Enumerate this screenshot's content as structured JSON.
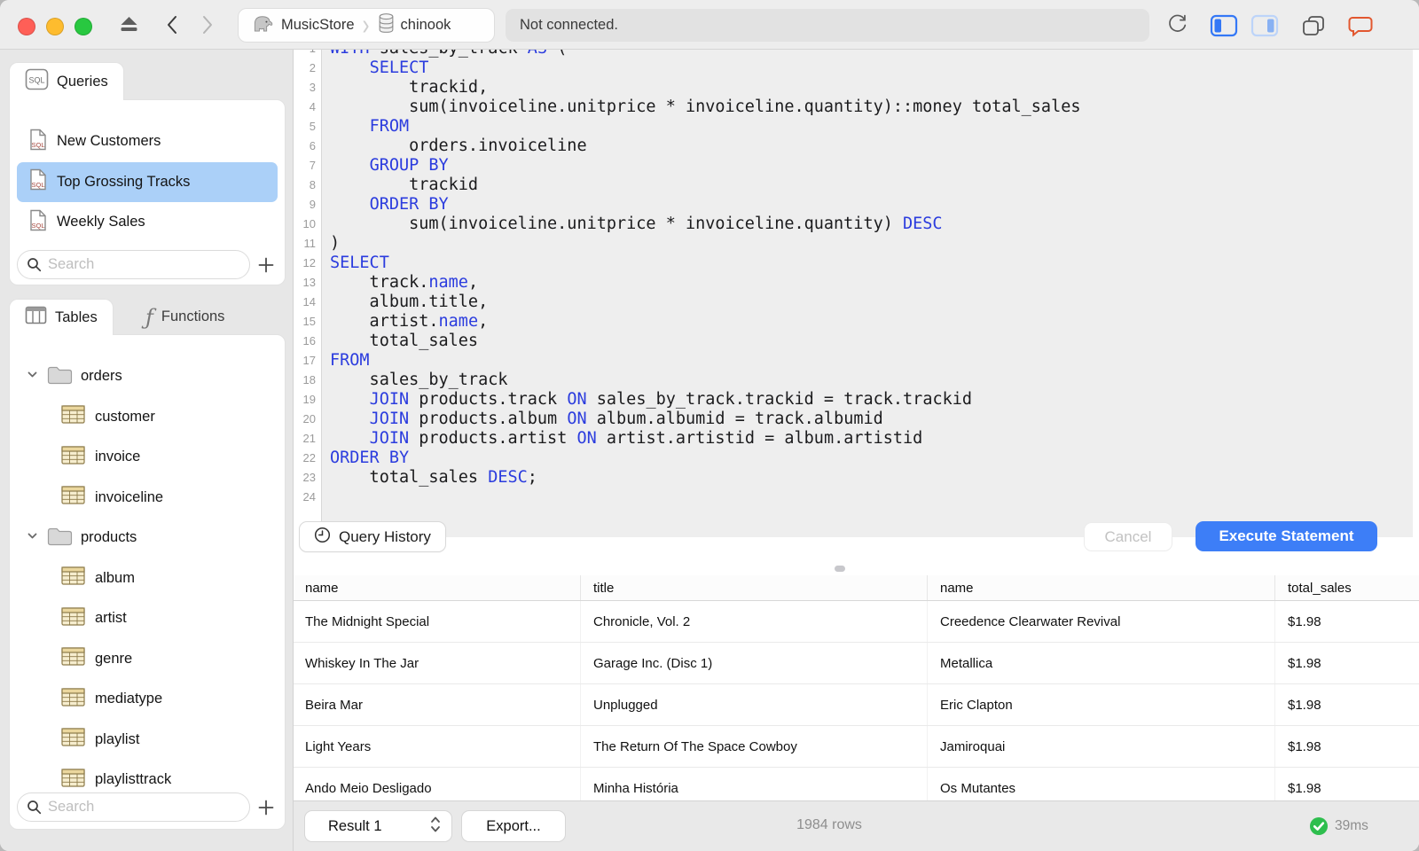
{
  "titlebar": {
    "breadcrumb": {
      "server": "MusicStore",
      "database": "chinook"
    },
    "status": "Not connected."
  },
  "sidebar": {
    "queries_tab_label": "Queries",
    "queries": [
      {
        "label": "New Customers",
        "selected": false
      },
      {
        "label": "Top Grossing Tracks",
        "selected": true
      },
      {
        "label": "Weekly Sales",
        "selected": false
      }
    ],
    "queries_search_placeholder": "Search",
    "tables_tab_label": "Tables",
    "functions_tab_label": "Functions",
    "tree": [
      {
        "kind": "schema",
        "label": "orders"
      },
      {
        "kind": "table",
        "label": "customer"
      },
      {
        "kind": "table",
        "label": "invoice"
      },
      {
        "kind": "table",
        "label": "invoiceline"
      },
      {
        "kind": "schema",
        "label": "products"
      },
      {
        "kind": "table",
        "label": "album"
      },
      {
        "kind": "table",
        "label": "artist"
      },
      {
        "kind": "table",
        "label": "genre"
      },
      {
        "kind": "table",
        "label": "mediatype"
      },
      {
        "kind": "table",
        "label": "playlist"
      },
      {
        "kind": "table",
        "label": "playlisttrack"
      }
    ],
    "tables_search_placeholder": "Search"
  },
  "editor": {
    "lines": [
      {
        "s": [
          [
            "WITH",
            1
          ],
          [
            " sales_by_track ",
            0
          ],
          [
            "AS",
            1
          ],
          [
            " (",
            0
          ]
        ]
      },
      {
        "s": [
          [
            "    ",
            0
          ],
          [
            "SELECT",
            1
          ]
        ]
      },
      {
        "s": [
          [
            "        trackid,",
            0
          ]
        ]
      },
      {
        "s": [
          [
            "        sum(invoiceline.unitprice * invoiceline.quantity)::money total_sales",
            0
          ]
        ]
      },
      {
        "s": [
          [
            "    ",
            0
          ],
          [
            "FROM",
            1
          ]
        ]
      },
      {
        "s": [
          [
            "        orders.invoiceline",
            0
          ]
        ]
      },
      {
        "s": [
          [
            "    ",
            0
          ],
          [
            "GROUP BY",
            1
          ]
        ]
      },
      {
        "s": [
          [
            "        trackid",
            0
          ]
        ]
      },
      {
        "s": [
          [
            "    ",
            0
          ],
          [
            "ORDER BY",
            1
          ]
        ]
      },
      {
        "s": [
          [
            "        sum(invoiceline.unitprice * invoiceline.quantity) ",
            0
          ],
          [
            "DESC",
            1
          ]
        ]
      },
      {
        "s": [
          [
            ")",
            0
          ]
        ]
      },
      {
        "s": [
          [
            "SELECT",
            1
          ]
        ]
      },
      {
        "s": [
          [
            "    track.",
            0
          ],
          [
            "name",
            1
          ],
          [
            ",",
            0
          ]
        ]
      },
      {
        "s": [
          [
            "    album.title,",
            0
          ]
        ]
      },
      {
        "s": [
          [
            "    artist.",
            0
          ],
          [
            "name",
            1
          ],
          [
            ",",
            0
          ]
        ]
      },
      {
        "s": [
          [
            "    total_sales",
            0
          ]
        ]
      },
      {
        "s": [
          [
            "FROM",
            1
          ]
        ]
      },
      {
        "s": [
          [
            "    sales_by_track",
            0
          ]
        ]
      },
      {
        "s": [
          [
            "    ",
            0
          ],
          [
            "JOIN",
            1
          ],
          [
            " products.track ",
            0
          ],
          [
            "ON",
            1
          ],
          [
            " sales_by_track.trackid = track.trackid",
            0
          ]
        ]
      },
      {
        "s": [
          [
            "    ",
            0
          ],
          [
            "JOIN",
            1
          ],
          [
            " products.album ",
            0
          ],
          [
            "ON",
            1
          ],
          [
            " album.albumid = track.albumid",
            0
          ]
        ]
      },
      {
        "s": [
          [
            "    ",
            0
          ],
          [
            "JOIN",
            1
          ],
          [
            " products.artist ",
            0
          ],
          [
            "ON",
            1
          ],
          [
            " artist.artistid = album.artistid",
            0
          ]
        ]
      },
      {
        "s": [
          [
            "ORDER BY",
            1
          ]
        ]
      },
      {
        "s": [
          [
            "    total_sales ",
            0
          ],
          [
            "DESC",
            1
          ],
          [
            ";",
            0
          ]
        ]
      },
      {
        "s": []
      }
    ],
    "query_history_label": "Query History",
    "cancel_label": "Cancel",
    "execute_label": "Execute Statement"
  },
  "results": {
    "columns": [
      "name",
      "title",
      "name",
      "total_sales"
    ],
    "rows": [
      [
        "The Midnight Special",
        "Chronicle, Vol. 2",
        "Creedence Clearwater Revival",
        "$1.98"
      ],
      [
        "Whiskey In The Jar",
        "Garage Inc. (Disc 1)",
        "Metallica",
        "$1.98"
      ],
      [
        "Beira Mar",
        "Unplugged",
        "Eric Clapton",
        "$1.98"
      ],
      [
        "Light Years",
        "The Return Of The Space Cowboy",
        "Jamiroquai",
        "$1.98"
      ],
      [
        "Ando Meio Desligado",
        "Minha História",
        "Os Mutantes",
        "$1.98"
      ]
    ],
    "result_selector": "Result 1",
    "export_label": "Export...",
    "row_count": "1984 rows",
    "duration": "39ms"
  },
  "icons": {
    "postgres-elephant-icon": "elephant silhouette",
    "database-icon": "cylinder",
    "sql-file-icon": "document with SQL badge",
    "folder-icon": "folder",
    "table-icon": "grid table",
    "functions-icon": "script f",
    "search-icon": "magnifier",
    "plus-icon": "+",
    "clock-icon": "clock",
    "eject-icon": "eject",
    "refresh-icon": "circular arrow",
    "check-icon": "checkmark"
  },
  "colors": {
    "accent_blue": "#3D7EF7",
    "selection_blue": "#ABD0F8",
    "keyword_blue": "#2B3CDE",
    "success_green": "#2EBE4E",
    "chat_orange": "#E2572F",
    "traffic_red": "#FF5F57",
    "traffic_yellow": "#FEBC2E",
    "traffic_green": "#28C840"
  }
}
